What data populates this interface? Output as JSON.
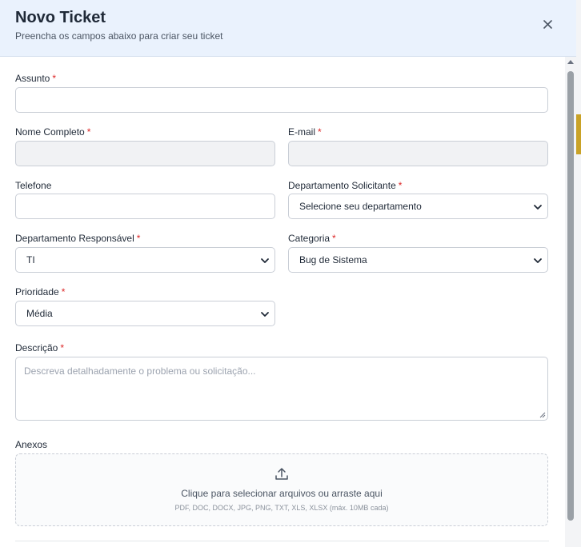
{
  "modal": {
    "title": "Novo Ticket",
    "subtitle": "Preencha os campos abaixo para criar seu ticket",
    "close_icon": "close-icon"
  },
  "form": {
    "assunto_label": "Assunto",
    "nome_label": "Nome Completo",
    "email_label": "E-mail",
    "telefone_label": "Telefone",
    "depto_solicitante_label": "Departamento Solicitante",
    "depto_solicitante_value": "Selecione seu departamento",
    "depto_responsavel_label": "Departamento Responsável",
    "depto_responsavel_value": "TI",
    "categoria_label": "Categoria",
    "categoria_value": "Bug de Sistema",
    "prioridade_label": "Prioridade",
    "prioridade_value": "Média",
    "descricao_label": "Descrição",
    "descricao_placeholder": "Descreva detalhadamente o problema ou solicitação...",
    "anexos_label": "Anexos",
    "anexos_text": "Clique para selecionar arquivos ou arraste aqui",
    "anexos_hint": "PDF, DOC, DOCX, JPG, PNG, TXT, XLS, XLSX (máx. 10MB cada)",
    "required_marker": "*"
  },
  "colors": {
    "header_bg": "#eaf2fd",
    "required": "#dc2626"
  }
}
